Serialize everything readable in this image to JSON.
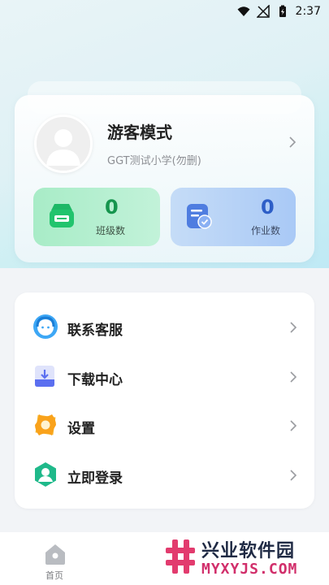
{
  "status_bar": {
    "time": "2:37",
    "icons": [
      "wifi-icon",
      "no-signal-icon",
      "battery-charging-icon"
    ]
  },
  "profile": {
    "name": "游客模式",
    "school": "GGT测试小学(勿删)",
    "avatar": "avatar-placeholder-icon"
  },
  "stats": [
    {
      "value": "0",
      "label": "班级数",
      "icon": "class-register-icon",
      "color": "#16954e"
    },
    {
      "value": "0",
      "label": "作业数",
      "icon": "homework-list-icon",
      "color": "#2d5ec7"
    }
  ],
  "menu": [
    {
      "label": "联系客服",
      "icon": "customer-service-icon"
    },
    {
      "label": "下载中心",
      "icon": "download-center-icon"
    },
    {
      "label": "设置",
      "icon": "settings-icon"
    },
    {
      "label": "立即登录",
      "icon": "login-user-icon"
    }
  ],
  "bottom_nav": {
    "home_label": "首页"
  },
  "watermark": {
    "line1": "兴业软件园",
    "line2": "MYXYJS.COM"
  }
}
